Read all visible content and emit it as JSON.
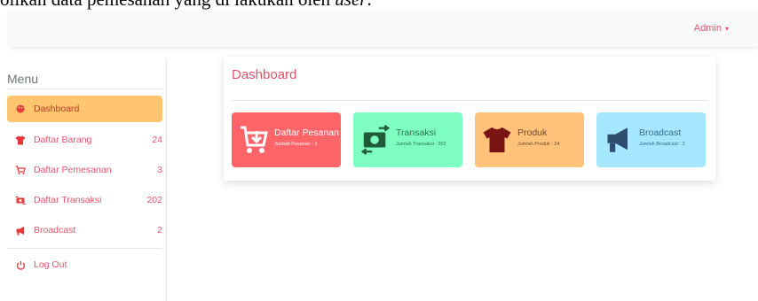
{
  "document_text": {
    "before": "olikan data pemesanan yang di lakukan oleh ",
    "italic": "user",
    "after": "."
  },
  "topbar": {
    "user_menu_label": "Admin",
    "caret": "▾"
  },
  "sidebar": {
    "title": "Menu",
    "items": [
      {
        "label": "Dashboard",
        "count": "",
        "icon": "palette-icon"
      },
      {
        "label": "Daftar Barang",
        "count": "24",
        "icon": "tshirt-icon"
      },
      {
        "label": "Daftar Pemesanan",
        "count": "3",
        "icon": "cart-icon"
      },
      {
        "label": "Daftar Transaksi",
        "count": "202",
        "icon": "money-exchange-icon"
      },
      {
        "label": "Broadcast",
        "count": "2",
        "icon": "megaphone-icon"
      },
      {
        "label": "Log Out",
        "count": "",
        "icon": "power-icon"
      }
    ]
  },
  "dashboard": {
    "title": "Dashboard",
    "tiles": [
      {
        "title": "Daftar Pesanan",
        "subtitle": "Jumlah Pesanan : 1",
        "icon": "cart-download-icon",
        "color": "#ff6468"
      },
      {
        "title": "Transaksi",
        "subtitle": "Jumlah Transaksi : 202",
        "icon": "money-exchange-icon",
        "color": "#7effc1"
      },
      {
        "title": "Produk",
        "subtitle": "Jumlah Produk : 24",
        "icon": "tshirt-icon",
        "color": "#ffc27a"
      },
      {
        "title": "Broadcast",
        "subtitle": "Jumlah Broadcast : 2",
        "icon": "megaphone-icon",
        "color": "#a4e7ff"
      }
    ]
  },
  "colors": {
    "accent": "#e2556b",
    "active_menu": "#ffc56f"
  }
}
